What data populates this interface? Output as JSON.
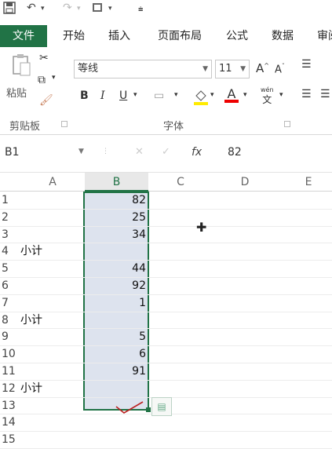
{
  "ribbon": {
    "tabs": [
      "文件",
      "开始",
      "插入",
      "页面布局",
      "公式",
      "数据",
      "审阅"
    ],
    "paste_label": "粘贴",
    "font_name": "等线",
    "font_size": "11",
    "grow_font": "A",
    "shrink_font": "A",
    "bold": "B",
    "italic": "I",
    "underline": "U",
    "font_color": "A",
    "phonetic": "wén",
    "phonetic_sub": "文",
    "clipboard_group": "剪贴板",
    "font_group": "字体"
  },
  "formula_bar": {
    "name_box": "B1",
    "fx": "fx",
    "value": "82"
  },
  "grid": {
    "columns": [
      "A",
      "B",
      "C",
      "D",
      "E"
    ],
    "row_numbers": [
      "1",
      "2",
      "3",
      "4",
      "5",
      "6",
      "7",
      "8",
      "9",
      "10",
      "11",
      "12",
      "13",
      "14",
      "15"
    ],
    "col_a": [
      "",
      "",
      "",
      "小计",
      "",
      "",
      "",
      "小计",
      "",
      "",
      "",
      "小计",
      "",
      "",
      ""
    ],
    "col_b": [
      "82",
      "25",
      "34",
      "",
      "44",
      "92",
      "1",
      "",
      "5",
      "6",
      "91",
      "",
      "",
      "",
      ""
    ]
  },
  "colors": {
    "accent": "#217346",
    "selection_fill": "#dde3ee"
  }
}
